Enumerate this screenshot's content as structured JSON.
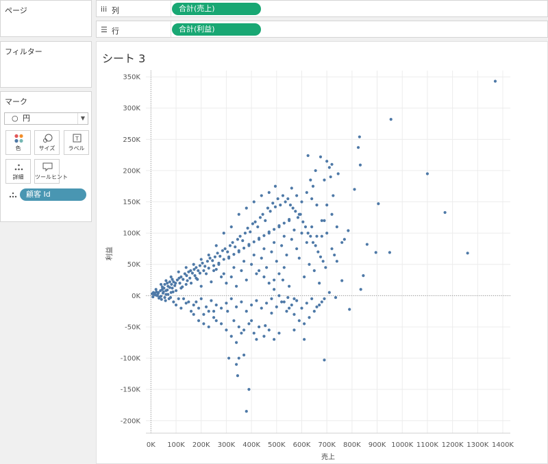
{
  "pages_panel": {
    "title": "ページ"
  },
  "filters_panel": {
    "title": "フィルター"
  },
  "marks_panel": {
    "title": "マーク",
    "mark_type": "円",
    "buttons": [
      {
        "label": "色",
        "icon": "color-dots-icon"
      },
      {
        "label": "サイズ",
        "icon": "size-icon"
      },
      {
        "label": "ラベル",
        "icon": "label-icon"
      },
      {
        "label": "詳細",
        "icon": "detail-dots-icon"
      },
      {
        "label": "ツールヒント",
        "icon": "tooltip-icon"
      }
    ],
    "detail_field": "顧客 Id"
  },
  "shelves": {
    "columns": {
      "icon": "iii",
      "label": "列",
      "pill": "合計(売上)"
    },
    "rows": {
      "icon": "☰",
      "label": "行",
      "pill": "合計(利益)"
    }
  },
  "sheet": {
    "title": "シート 3"
  },
  "colors": {
    "mark": "#4e79a7",
    "column_pill": "#18a773",
    "detail_pill": "#4996b2"
  },
  "chart_data": {
    "type": "scatter",
    "xlabel": "売上",
    "ylabel": "利益",
    "xlim": [
      -20000,
      1430000
    ],
    "ylim": [
      -220000,
      360000
    ],
    "x_ticks": [
      {
        "v": 0,
        "label": "0K"
      },
      {
        "v": 100000,
        "label": "100K"
      },
      {
        "v": 200000,
        "label": "200K"
      },
      {
        "v": 300000,
        "label": "300K"
      },
      {
        "v": 400000,
        "label": "400K"
      },
      {
        "v": 500000,
        "label": "500K"
      },
      {
        "v": 600000,
        "label": "600K"
      },
      {
        "v": 700000,
        "label": "700K"
      },
      {
        "v": 800000,
        "label": "800K"
      },
      {
        "v": 900000,
        "label": "900K"
      },
      {
        "v": 1000000,
        "label": "1000K"
      },
      {
        "v": 1100000,
        "label": "1100K"
      },
      {
        "v": 1200000,
        "label": "1200K"
      },
      {
        "v": 1300000,
        "label": "1300K"
      },
      {
        "v": 1400000,
        "label": "1400K"
      }
    ],
    "y_ticks": [
      {
        "v": 350000,
        "label": "350K"
      },
      {
        "v": 300000,
        "label": "300K"
      },
      {
        "v": 250000,
        "label": "250K"
      },
      {
        "v": 200000,
        "label": "200K"
      },
      {
        "v": 150000,
        "label": "150K"
      },
      {
        "v": 100000,
        "label": "100K"
      },
      {
        "v": 50000,
        "label": "50K"
      },
      {
        "v": 0,
        "label": "0K"
      },
      {
        "v": -50000,
        "label": "-50K"
      },
      {
        "v": -100000,
        "label": "-100K"
      },
      {
        "v": -150000,
        "label": "-150K"
      },
      {
        "v": -200000,
        "label": "-200K"
      }
    ],
    "points": [
      [
        1370000,
        343000
      ],
      [
        955000,
        282000
      ],
      [
        830000,
        254000
      ],
      [
        825000,
        237000
      ],
      [
        1100000,
        195000
      ],
      [
        1170000,
        133000
      ],
      [
        1260000,
        68000
      ],
      [
        905000,
        147000
      ],
      [
        950000,
        69000
      ],
      [
        895000,
        69000
      ],
      [
        860000,
        82000
      ],
      [
        833000,
        209000
      ],
      [
        810000,
        170000
      ],
      [
        785000,
        104000
      ],
      [
        770000,
        90000
      ],
      [
        760000,
        24000
      ],
      [
        845000,
        32000
      ],
      [
        835000,
        10000
      ],
      [
        790000,
        -22000
      ],
      [
        735000,
        -3000
      ],
      [
        720000,
        210000
      ],
      [
        710000,
        205000
      ],
      [
        700000,
        215000
      ],
      [
        690000,
        185000
      ],
      [
        745000,
        195000
      ],
      [
        675000,
        222000
      ],
      [
        655000,
        200000
      ],
      [
        625000,
        224000
      ],
      [
        635000,
        185000
      ],
      [
        645000,
        175000
      ],
      [
        715000,
        190000
      ],
      [
        725000,
        160000
      ],
      [
        700000,
        145000
      ],
      [
        690000,
        120000
      ],
      [
        680000,
        95000
      ],
      [
        720000,
        75000
      ],
      [
        740000,
        55000
      ],
      [
        690000,
        -103000
      ],
      [
        610000,
        -70000
      ],
      [
        570000,
        -55000
      ],
      [
        545000,
        -3000
      ],
      [
        525000,
        25000
      ],
      [
        480000,
        -28000
      ],
      [
        455000,
        -48000
      ],
      [
        420000,
        -70000
      ],
      [
        400000,
        -40000
      ],
      [
        380000,
        -185000
      ],
      [
        390000,
        -150000
      ],
      [
        345000,
        -128000
      ],
      [
        340000,
        -110000
      ],
      [
        310000,
        -100000
      ],
      [
        370000,
        -95000
      ],
      [
        350000,
        -100000
      ],
      [
        305000,
        -25000
      ],
      [
        260000,
        -40000
      ],
      [
        250000,
        -25000
      ],
      [
        230000,
        -25000
      ],
      [
        210000,
        -30000
      ],
      [
        190000,
        -20000
      ],
      [
        170000,
        -15000
      ],
      [
        150000,
        -10000
      ],
      [
        130000,
        -5000
      ],
      [
        110000,
        -5000
      ],
      [
        90000,
        -10000
      ],
      [
        72000,
        -5000
      ],
      [
        55000,
        -3000
      ],
      [
        40000,
        -1000
      ],
      [
        25000,
        0
      ],
      [
        12000,
        2000
      ],
      [
        5000,
        3000
      ],
      [
        15000,
        4000
      ],
      [
        22000,
        6000
      ],
      [
        30000,
        5000
      ],
      [
        38000,
        8000
      ],
      [
        45000,
        10000
      ],
      [
        52000,
        12000
      ],
      [
        60000,
        8000
      ],
      [
        68000,
        15000
      ],
      [
        75000,
        13000
      ],
      [
        82000,
        18000
      ],
      [
        90000,
        22000
      ],
      [
        98000,
        20000
      ],
      [
        105000,
        25000
      ],
      [
        112000,
        28000
      ],
      [
        120000,
        30000
      ],
      [
        128000,
        26000
      ],
      [
        135000,
        35000
      ],
      [
        142000,
        32000
      ],
      [
        150000,
        38000
      ],
      [
        158000,
        40000
      ],
      [
        165000,
        36000
      ],
      [
        172000,
        42000
      ],
      [
        180000,
        45000
      ],
      [
        188000,
        40000
      ],
      [
        195000,
        48000
      ],
      [
        205000,
        52000
      ],
      [
        215000,
        47000
      ],
      [
        225000,
        55000
      ],
      [
        235000,
        60000
      ],
      [
        245000,
        56000
      ],
      [
        255000,
        62000
      ],
      [
        265000,
        68000
      ],
      [
        275000,
        63000
      ],
      [
        285000,
        72000
      ],
      [
        295000,
        75000
      ],
      [
        305000,
        70000
      ],
      [
        315000,
        80000
      ],
      [
        325000,
        85000
      ],
      [
        335000,
        78000
      ],
      [
        345000,
        90000
      ],
      [
        355000,
        95000
      ],
      [
        365000,
        88000
      ],
      [
        375000,
        100000
      ],
      [
        385000,
        108000
      ],
      [
        395000,
        102000
      ],
      [
        405000,
        115000
      ],
      [
        415000,
        118000
      ],
      [
        425000,
        110000
      ],
      [
        435000,
        125000
      ],
      [
        445000,
        130000
      ],
      [
        455000,
        120000
      ],
      [
        465000,
        140000
      ],
      [
        475000,
        135000
      ],
      [
        485000,
        148000
      ],
      [
        495000,
        142000
      ],
      [
        505000,
        155000
      ],
      [
        515000,
        145000
      ],
      [
        525000,
        160000
      ],
      [
        535000,
        150000
      ],
      [
        545000,
        155000
      ],
      [
        555000,
        145000
      ],
      [
        565000,
        140000
      ],
      [
        575000,
        135000
      ],
      [
        585000,
        125000
      ],
      [
        595000,
        130000
      ],
      [
        605000,
        118000
      ],
      [
        615000,
        110000
      ],
      [
        625000,
        100000
      ],
      [
        635000,
        95000
      ],
      [
        645000,
        85000
      ],
      [
        655000,
        80000
      ],
      [
        665000,
        70000
      ],
      [
        675000,
        62000
      ],
      [
        685000,
        55000
      ],
      [
        695000,
        45000
      ],
      [
        560000,
        172000
      ],
      [
        495000,
        175000
      ],
      [
        470000,
        165000
      ],
      [
        440000,
        160000
      ],
      [
        410000,
        150000
      ],
      [
        380000,
        140000
      ],
      [
        350000,
        130000
      ],
      [
        320000,
        110000
      ],
      [
        290000,
        100000
      ],
      [
        260000,
        80000
      ],
      [
        230000,
        65000
      ],
      [
        200000,
        58000
      ],
      [
        170000,
        50000
      ],
      [
        140000,
        45000
      ],
      [
        110000,
        38000
      ],
      [
        80000,
        30000
      ],
      [
        60000,
        24000
      ],
      [
        40000,
        18000
      ],
      [
        20000,
        10000
      ],
      [
        10000,
        5000
      ],
      [
        100000,
        -15000
      ],
      [
        120000,
        -20000
      ],
      [
        140000,
        -12000
      ],
      [
        160000,
        -25000
      ],
      [
        180000,
        -10000
      ],
      [
        200000,
        -5000
      ],
      [
        220000,
        -18000
      ],
      [
        240000,
        -8000
      ],
      [
        260000,
        -15000
      ],
      [
        280000,
        -20000
      ],
      [
        300000,
        -12000
      ],
      [
        320000,
        -5000
      ],
      [
        340000,
        -18000
      ],
      [
        360000,
        -10000
      ],
      [
        380000,
        -25000
      ],
      [
        400000,
        -15000
      ],
      [
        420000,
        -8000
      ],
      [
        440000,
        -20000
      ],
      [
        460000,
        -12000
      ],
      [
        480000,
        -5000
      ],
      [
        500000,
        -18000
      ],
      [
        520000,
        -10000
      ],
      [
        540000,
        -25000
      ],
      [
        560000,
        -15000
      ],
      [
        580000,
        -8000
      ],
      [
        600000,
        -20000
      ],
      [
        620000,
        -12000
      ],
      [
        640000,
        -5000
      ],
      [
        660000,
        -18000
      ],
      [
        680000,
        -10000
      ],
      [
        300000,
        20000
      ],
      [
        320000,
        30000
      ],
      [
        340000,
        15000
      ],
      [
        360000,
        40000
      ],
      [
        380000,
        25000
      ],
      [
        400000,
        50000
      ],
      [
        420000,
        35000
      ],
      [
        440000,
        60000
      ],
      [
        460000,
        45000
      ],
      [
        480000,
        70000
      ],
      [
        500000,
        55000
      ],
      [
        520000,
        80000
      ],
      [
        540000,
        65000
      ],
      [
        560000,
        90000
      ],
      [
        580000,
        75000
      ],
      [
        600000,
        100000
      ],
      [
        620000,
        85000
      ],
      [
        640000,
        110000
      ],
      [
        660000,
        95000
      ],
      [
        680000,
        120000
      ],
      [
        250000,
        40000
      ],
      [
        270000,
        50000
      ],
      [
        290000,
        35000
      ],
      [
        310000,
        60000
      ],
      [
        330000,
        45000
      ],
      [
        350000,
        70000
      ],
      [
        370000,
        55000
      ],
      [
        390000,
        80000
      ],
      [
        410000,
        65000
      ],
      [
        430000,
        90000
      ],
      [
        450000,
        75000
      ],
      [
        470000,
        100000
      ],
      [
        490000,
        85000
      ],
      [
        510000,
        110000
      ],
      [
        530000,
        95000
      ],
      [
        550000,
        120000
      ],
      [
        570000,
        105000
      ],
      [
        590000,
        130000
      ],
      [
        160000,
        20000
      ],
      [
        180000,
        28000
      ],
      [
        200000,
        15000
      ],
      [
        220000,
        35000
      ],
      [
        240000,
        22000
      ],
      [
        260000,
        42000
      ],
      [
        280000,
        30000
      ],
      [
        140000,
        18000
      ],
      [
        120000,
        12000
      ],
      [
        100000,
        8000
      ],
      [
        80000,
        5000
      ],
      [
        60000,
        2000
      ],
      [
        35000,
        -2000
      ],
      [
        50000,
        6000
      ],
      [
        65000,
        9000
      ],
      [
        85000,
        12000
      ],
      [
        95000,
        16000
      ],
      [
        115000,
        20000
      ],
      [
        125000,
        14000
      ],
      [
        145000,
        24000
      ],
      [
        155000,
        28000
      ],
      [
        175000,
        32000
      ],
      [
        185000,
        26000
      ],
      [
        195000,
        36000
      ],
      [
        210000,
        40000
      ],
      [
        230000,
        44000
      ],
      [
        250000,
        48000
      ],
      [
        270000,
        52000
      ],
      [
        290000,
        58000
      ],
      [
        310000,
        62000
      ],
      [
        330000,
        66000
      ],
      [
        350000,
        72000
      ],
      [
        370000,
        76000
      ],
      [
        390000,
        82000
      ],
      [
        410000,
        86000
      ],
      [
        430000,
        92000
      ],
      [
        450000,
        96000
      ],
      [
        470000,
        102000
      ],
      [
        490000,
        106000
      ],
      [
        510000,
        112000
      ],
      [
        530000,
        116000
      ],
      [
        550000,
        122000
      ],
      [
        430000,
        40000
      ],
      [
        450000,
        30000
      ],
      [
        470000,
        20000
      ],
      [
        490000,
        10000
      ],
      [
        510000,
        0
      ],
      [
        530000,
        -10000
      ],
      [
        550000,
        -20000
      ],
      [
        570000,
        -30000
      ],
      [
        590000,
        -40000
      ],
      [
        610000,
        -45000
      ],
      [
        630000,
        -35000
      ],
      [
        650000,
        -25000
      ],
      [
        670000,
        -15000
      ],
      [
        690000,
        -5000
      ],
      [
        710000,
        5000
      ],
      [
        330000,
        -40000
      ],
      [
        350000,
        -50000
      ],
      [
        370000,
        -55000
      ],
      [
        390000,
        -45000
      ],
      [
        410000,
        -60000
      ],
      [
        430000,
        -50000
      ],
      [
        450000,
        -65000
      ],
      [
        470000,
        -55000
      ],
      [
        490000,
        -70000
      ],
      [
        510000,
        -60000
      ],
      [
        280000,
        -45000
      ],
      [
        300000,
        -55000
      ],
      [
        320000,
        -65000
      ],
      [
        340000,
        -75000
      ],
      [
        360000,
        -60000
      ],
      [
        210000,
        -45000
      ],
      [
        230000,
        -50000
      ],
      [
        250000,
        -35000
      ],
      [
        190000,
        -40000
      ],
      [
        170000,
        -30000
      ],
      [
        610000,
        30000
      ],
      [
        630000,
        50000
      ],
      [
        650000,
        40000
      ],
      [
        670000,
        20000
      ],
      [
        590000,
        60000
      ],
      [
        570000,
        -5000
      ],
      [
        550000,
        15000
      ],
      [
        530000,
        45000
      ],
      [
        510000,
        35000
      ],
      [
        490000,
        25000
      ],
      [
        45000,
        14000
      ],
      [
        55000,
        18000
      ],
      [
        65000,
        20000
      ],
      [
        75000,
        22000
      ],
      [
        85000,
        26000
      ],
      [
        28000,
        3000
      ],
      [
        18000,
        1000
      ],
      [
        8000,
        -2000
      ],
      [
        32000,
        -4000
      ],
      [
        42000,
        -6000
      ],
      [
        48000,
        4000
      ],
      [
        58000,
        -8000
      ],
      [
        68000,
        2000
      ],
      [
        78000,
        -3000
      ],
      [
        88000,
        6000
      ],
      [
        660000,
        145000
      ],
      [
        640000,
        155000
      ],
      [
        620000,
        165000
      ],
      [
        600000,
        150000
      ],
      [
        580000,
        160000
      ],
      [
        720000,
        130000
      ],
      [
        740000,
        110000
      ],
      [
        760000,
        85000
      ],
      [
        700000,
        100000
      ],
      [
        730000,
        65000
      ]
    ]
  }
}
